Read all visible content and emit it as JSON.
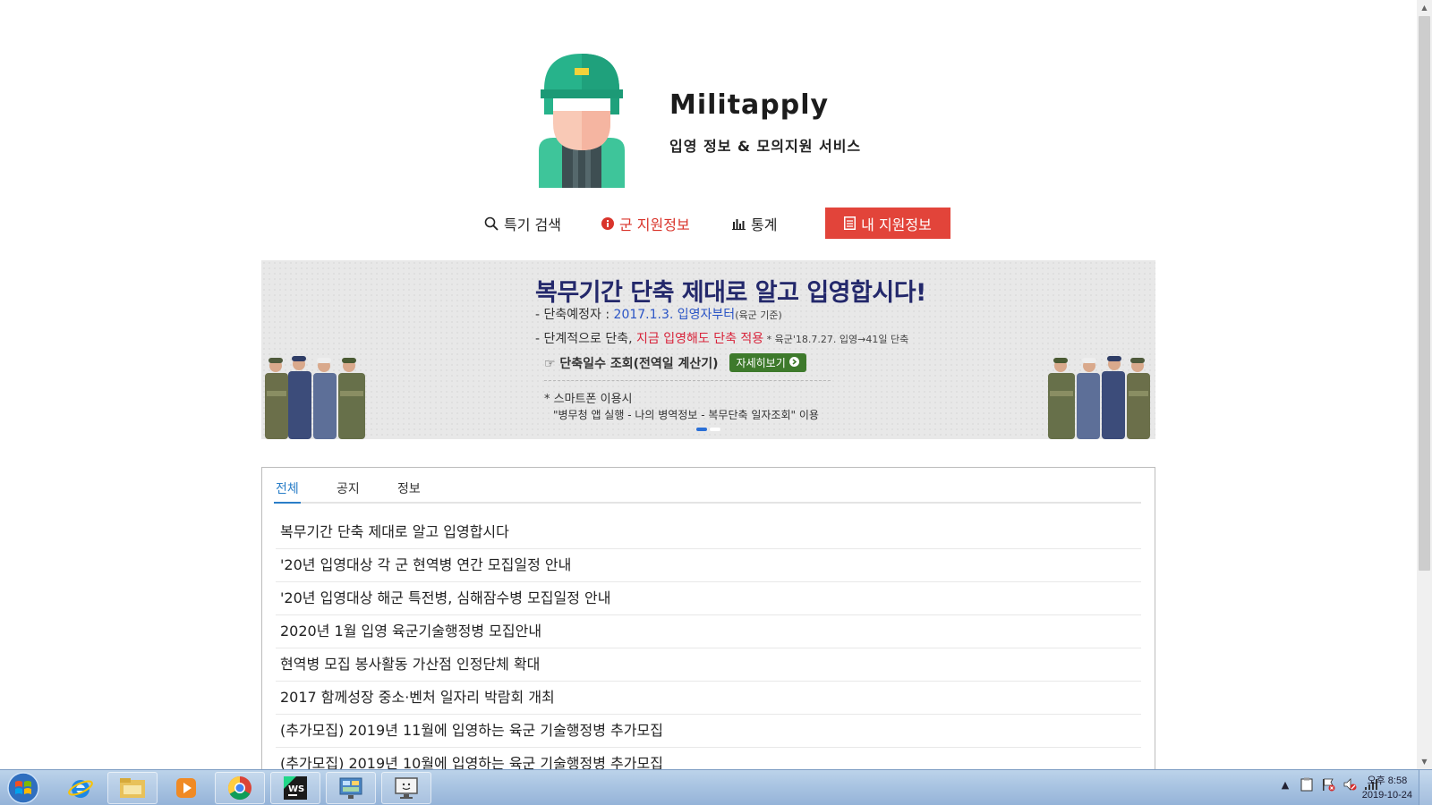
{
  "brand": {
    "title": "Militapply",
    "subtitle": "입영 정보 & 모의지원 서비스"
  },
  "nav": {
    "search": "특기 검색",
    "info": "군 지원정보",
    "stats": "통계",
    "my_application": "내 지원정보"
  },
  "banner": {
    "headline": "복무기간 단축 제대로 알고 입영합시다!",
    "line1_prefix": "- 단축예정자 : ",
    "line1_highlight": "2017.1.3. 입영자부터",
    "line1_suffix": "(육군 기준)",
    "line2_prefix": "- 단계적으로 단축, ",
    "line2_highlight": "지금 입영해도 단축 적용",
    "line2_note": " * 육군'18.7.27. 입영→41일 단축",
    "line3": "☞ 단축일수 조회(전역일 계산기)",
    "detail_button": "자세히보기",
    "line4": "* 스마트폰 이용시",
    "line5": "\"병무청 앱 실행 - 나의 병역정보 - 복무단축 일자조회\" 이용"
  },
  "tabs": [
    "전체",
    "공지",
    "정보"
  ],
  "news": [
    "복무기간 단축 제대로 알고 입영합시다",
    "'20년 입영대상 각 군 현역병 연간 모집일정 안내",
    "'20년 입영대상 해군 특전병, 심해잠수병 모집일정 안내",
    "2020년 1월 입영 육군기술행정병 모집안내",
    "현역병 모집 봉사활동 가산점 인정단체 확대",
    "2017 함께성장 중소·벤처 일자리 박람회 개최",
    "(추가모집) 2019년 11월에 입영하는 육군 기술행정병 추가모집",
    "(추가모집) 2019년 10월에 입영하는 육군 기술행정병 추가모집"
  ],
  "taskbar": {
    "clock_time": "오후 8:58",
    "clock_date": "2019-10-24"
  },
  "colors": {
    "accent_red": "#e2443a",
    "tab_active": "#2a7ec8",
    "banner_navy": "#23286b"
  }
}
